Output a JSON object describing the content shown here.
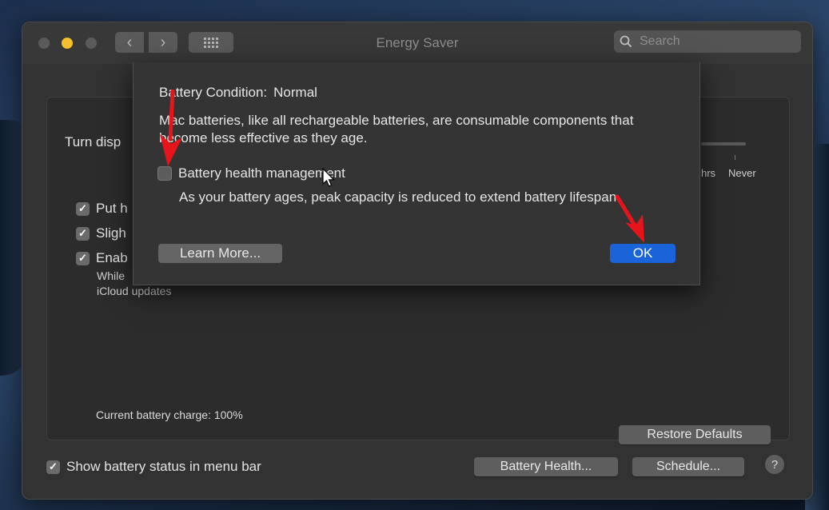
{
  "window": {
    "title": "Energy Saver",
    "search_placeholder": "Search"
  },
  "panel": {
    "turn_off_label": "Turn disp",
    "slider_labels": {
      "hrs": "hrs",
      "never": "Never"
    },
    "options": [
      {
        "label": "Put h",
        "checked": true
      },
      {
        "label": "Sligh",
        "checked": true
      },
      {
        "label": "Enab",
        "checked": true
      }
    ],
    "option_note_line1": "While",
    "option_note_line2": "iCloud updates",
    "battery_charge": "Current battery charge: 100%",
    "restore_defaults": "Restore Defaults"
  },
  "footer": {
    "show_status_label": "Show battery status in menu bar",
    "show_status_checked": true,
    "battery_health_button": "Battery Health...",
    "schedule_button": "Schedule...",
    "help_label": "?"
  },
  "sheet": {
    "condition_label": "Battery Condition:",
    "condition_value": "Normal",
    "description": "Mac batteries, like all rechargeable batteries, are consumable components that become less effective as they age.",
    "management_label": "Battery health management",
    "management_checked": false,
    "management_description": "As your battery ages, peak capacity is reduced to extend battery lifespan.",
    "learn_more_button": "Learn More...",
    "ok_button": "OK"
  },
  "colors": {
    "accent": "#1a63d8",
    "annotation_arrow": "#e8141b",
    "minimize_light": "#f5c02c"
  }
}
